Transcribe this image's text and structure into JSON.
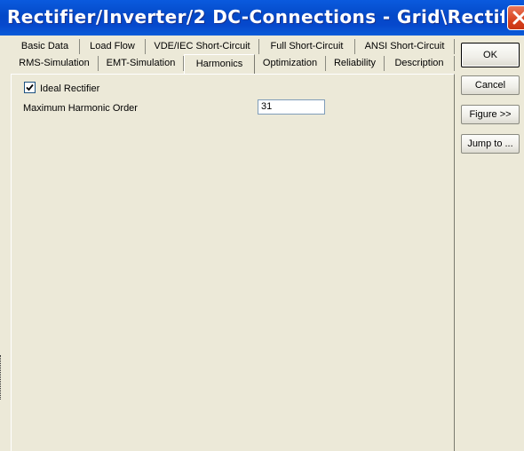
{
  "window": {
    "title": "Rectifier/Inverter/2 DC-Connections - Grid\\Rectifier/Invert..."
  },
  "tabs": {
    "row1": [
      "Basic Data",
      "Load Flow",
      "VDE/IEC Short-Circuit",
      "Full Short-Circuit",
      "ANSI Short-Circuit"
    ],
    "row2": [
      "RMS-Simulation",
      "EMT-Simulation",
      "Harmonics",
      "Optimization",
      "Reliability",
      "Description"
    ],
    "active": "Harmonics"
  },
  "form": {
    "ideal_rectifier": {
      "label": "Ideal Rectifier",
      "checked": true
    },
    "max_harmonic_order": {
      "label": "Maximum Harmonic Order",
      "value": "31"
    }
  },
  "buttons": {
    "ok": "OK",
    "cancel": "Cancel",
    "figure": "Figure >>",
    "jump_to": "Jump to ..."
  },
  "icons": {
    "close": "close-icon",
    "checkbox": "checkmark-icon"
  },
  "colors": {
    "title_bar": "#0449c8",
    "close_button": "#d9431f",
    "dialog_face": "#ece9d8"
  }
}
